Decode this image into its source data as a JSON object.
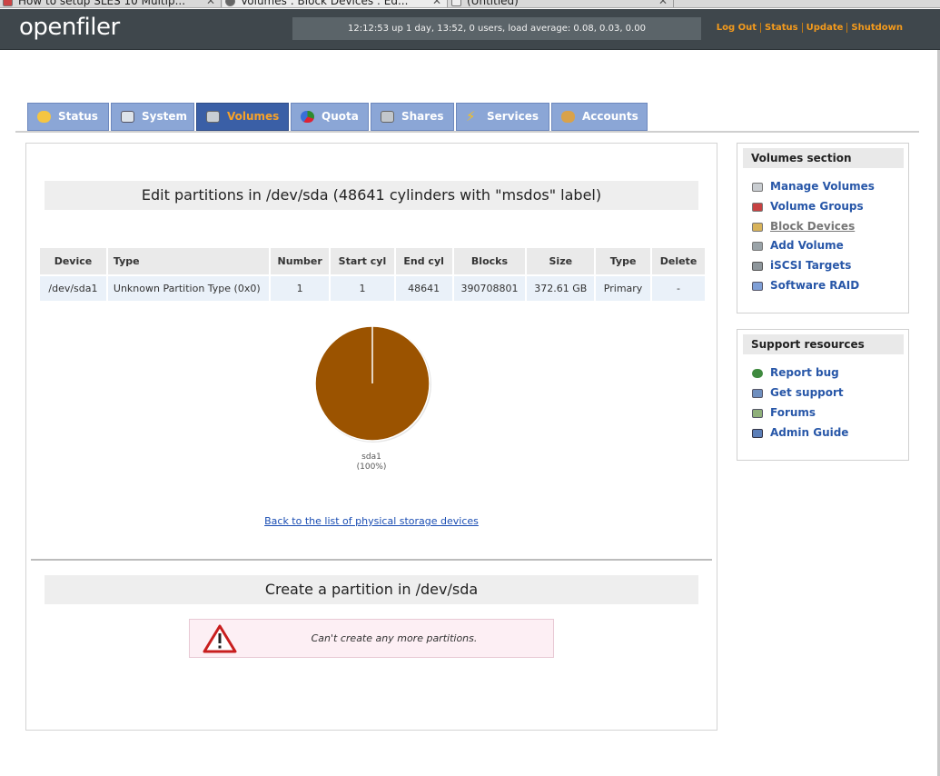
{
  "browser_tabs": [
    {
      "title": "How to setup SLES 10 Multip...",
      "close": "✕"
    },
    {
      "title": "Volumes : Block Devices : Ed...",
      "close": "✕"
    },
    {
      "title": "(Untitled)",
      "close": "✕"
    }
  ],
  "header": {
    "logo": "openfiler",
    "uptime": "12:12:53 up 1 day, 13:52, 0 users, load average: 0.08, 0.03, 0.00",
    "links": {
      "logout": "Log Out",
      "status": "Status",
      "update": "Update",
      "shutdown": "Shutdown"
    }
  },
  "nav_tabs": [
    {
      "label": "Status",
      "icon": "sun-icon",
      "active": false
    },
    {
      "label": "System",
      "icon": "monitor-icon",
      "active": false
    },
    {
      "label": "Volumes",
      "icon": "disk-icon",
      "active": true
    },
    {
      "label": "Quota",
      "icon": "pie-icon",
      "active": false
    },
    {
      "label": "Shares",
      "icon": "server-icon",
      "active": false
    },
    {
      "label": "Services",
      "icon": "lightning-icon",
      "active": false
    },
    {
      "label": "Accounts",
      "icon": "users-icon",
      "active": false
    }
  ],
  "main": {
    "edit_title": "Edit partitions in /dev/sda (48641 cylinders with \"msdos\" label)",
    "table": {
      "headers": [
        "Device",
        "Type",
        "Number",
        "Start cyl",
        "End cyl",
        "Blocks",
        "Size",
        "Type",
        "Delete"
      ],
      "rows": [
        [
          "/dev/sda1",
          "Unknown Partition Type (0x0)",
          "1",
          "1",
          "48641",
          "390708801",
          "372.61 GB",
          "Primary",
          "-"
        ]
      ]
    },
    "pie": {
      "label": "sda1",
      "percent_label": "(100%)",
      "share": 100,
      "color": "#9b5300"
    },
    "back_link": "Back to the list of physical storage devices",
    "create_title": "Create a partition in /dev/sda",
    "warning": "Can't create any more partitions."
  },
  "sidebar": {
    "volumes_head": "Volumes section",
    "volumes_items": [
      {
        "label": "Manage Volumes",
        "icon": "disk-icon",
        "current": false
      },
      {
        "label": "Volume Groups",
        "icon": "volume-groups-icon",
        "current": false
      },
      {
        "label": "Block Devices",
        "icon": "block-device-icon",
        "current": true
      },
      {
        "label": "Add Volume",
        "icon": "add-volume-icon",
        "current": false
      },
      {
        "label": "iSCSI Targets",
        "icon": "iscsi-icon",
        "current": false
      },
      {
        "label": "Software RAID",
        "icon": "raid-icon",
        "current": false
      }
    ],
    "support_head": "Support resources",
    "support_items": [
      {
        "label": "Report bug",
        "icon": "bug-icon"
      },
      {
        "label": "Get support",
        "icon": "support-icon"
      },
      {
        "label": "Forums",
        "icon": "forums-icon"
      },
      {
        "label": "Admin Guide",
        "icon": "book-icon"
      }
    ]
  }
}
